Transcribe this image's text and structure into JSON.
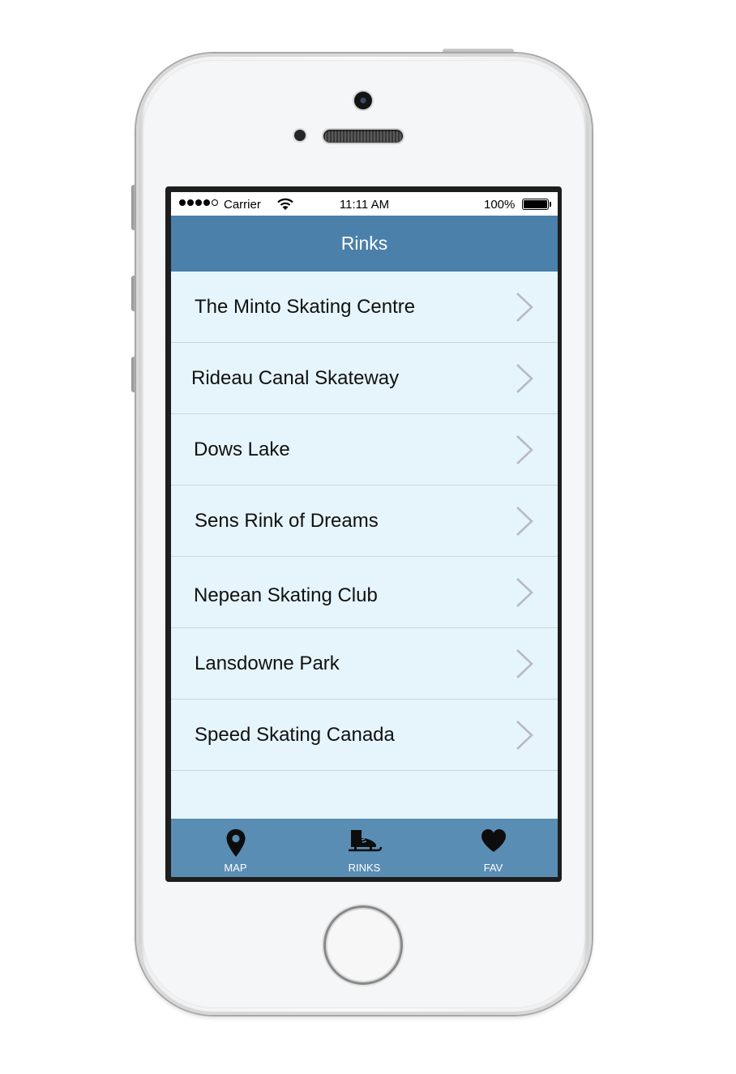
{
  "status_bar": {
    "carrier": "Carrier",
    "time": "11:11 AM",
    "battery": "100%"
  },
  "nav": {
    "title": "Rinks"
  },
  "rinks": [
    {
      "name": "The Minto Skating Centre"
    },
    {
      "name": "Rideau Canal Skateway"
    },
    {
      "name": "Dows Lake"
    },
    {
      "name": "Sens Rink of Dreams"
    },
    {
      "name": "Nepean Skating Club"
    },
    {
      "name": "Lansdowne Park"
    },
    {
      "name": "Speed Skating Canada"
    }
  ],
  "tabs": [
    {
      "label": "MAP",
      "icon": "map-pin-icon"
    },
    {
      "label": "RINKS",
      "icon": "ice-skate-icon"
    },
    {
      "label": "FAV",
      "icon": "heart-icon"
    }
  ],
  "colors": {
    "nav_bar": "#4a80aa",
    "tab_bar": "#5a8db3",
    "list_background": "#e6f5fb",
    "chevron": "#b9b9c6"
  }
}
